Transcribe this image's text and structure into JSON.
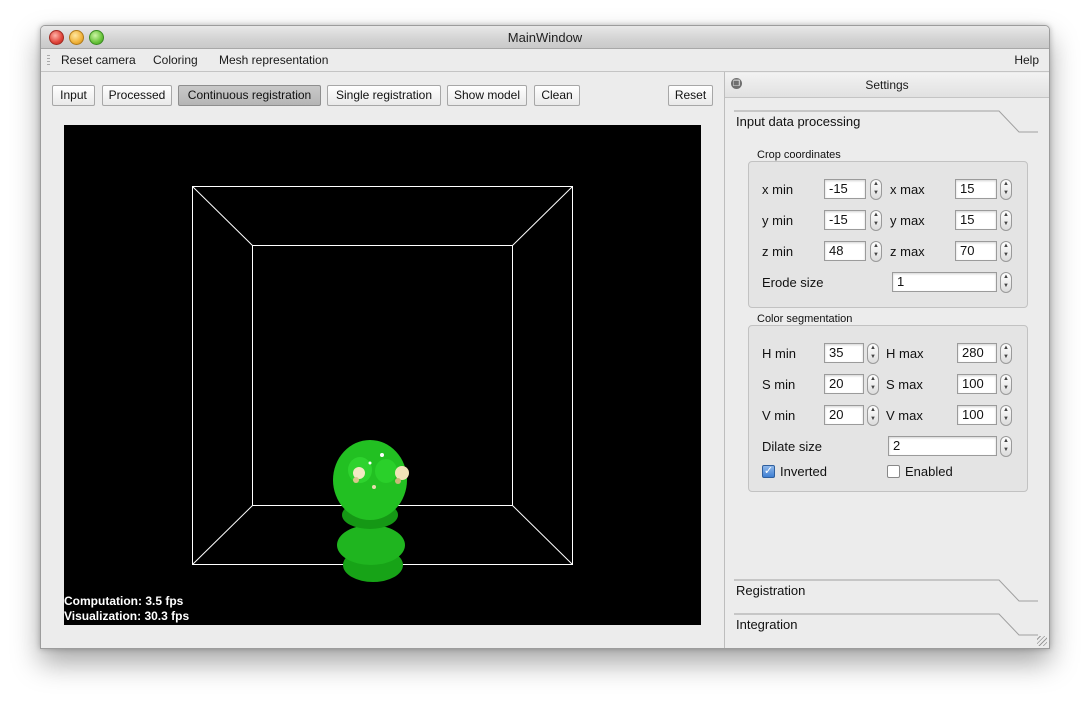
{
  "window": {
    "title": "MainWindow"
  },
  "menu": {
    "reset_camera": "Reset camera",
    "coloring": "Coloring",
    "mesh_representation": "Mesh representation",
    "help": "Help"
  },
  "toolbar": {
    "input": "Input",
    "processed": "Processed",
    "continuous_registration": "Continuous registration",
    "single_registration": "Single registration",
    "show_model": "Show model",
    "clean": "Clean",
    "reset": "Reset",
    "active_button": "Continuous registration"
  },
  "viewport": {
    "computation": "Computation: 3.5 fps",
    "visualization": "Visualization: 30.3 fps",
    "object_color": "#1fb51f"
  },
  "settings": {
    "title": "Settings",
    "sections": {
      "input": "Input data processing",
      "registration": "Registration",
      "integration": "Integration"
    },
    "crop": {
      "title": "Crop coordinates",
      "x_min_label": "x min",
      "x_min": "-15",
      "x_max_label": "x max",
      "x_max": "15",
      "y_min_label": "y min",
      "y_min": "-15",
      "y_max_label": "y max",
      "y_max": "15",
      "z_min_label": "z min",
      "z_min": "48",
      "z_max_label": "z max",
      "z_max": "70",
      "erode_label": "Erode size",
      "erode": "1"
    },
    "color": {
      "title": "Color segmentation",
      "h_min_label": "H min",
      "h_min": "35",
      "h_max_label": "H max",
      "h_max": "280",
      "s_min_label": "S min",
      "s_min": "20",
      "s_max_label": "S max",
      "s_max": "100",
      "v_min_label": "V min",
      "v_min": "20",
      "v_max_label": "V max",
      "v_max": "100",
      "dilate_label": "Dilate size",
      "dilate": "2",
      "inverted_label": "Inverted",
      "inverted": true,
      "enabled_label": "Enabled",
      "enabled": false
    }
  }
}
